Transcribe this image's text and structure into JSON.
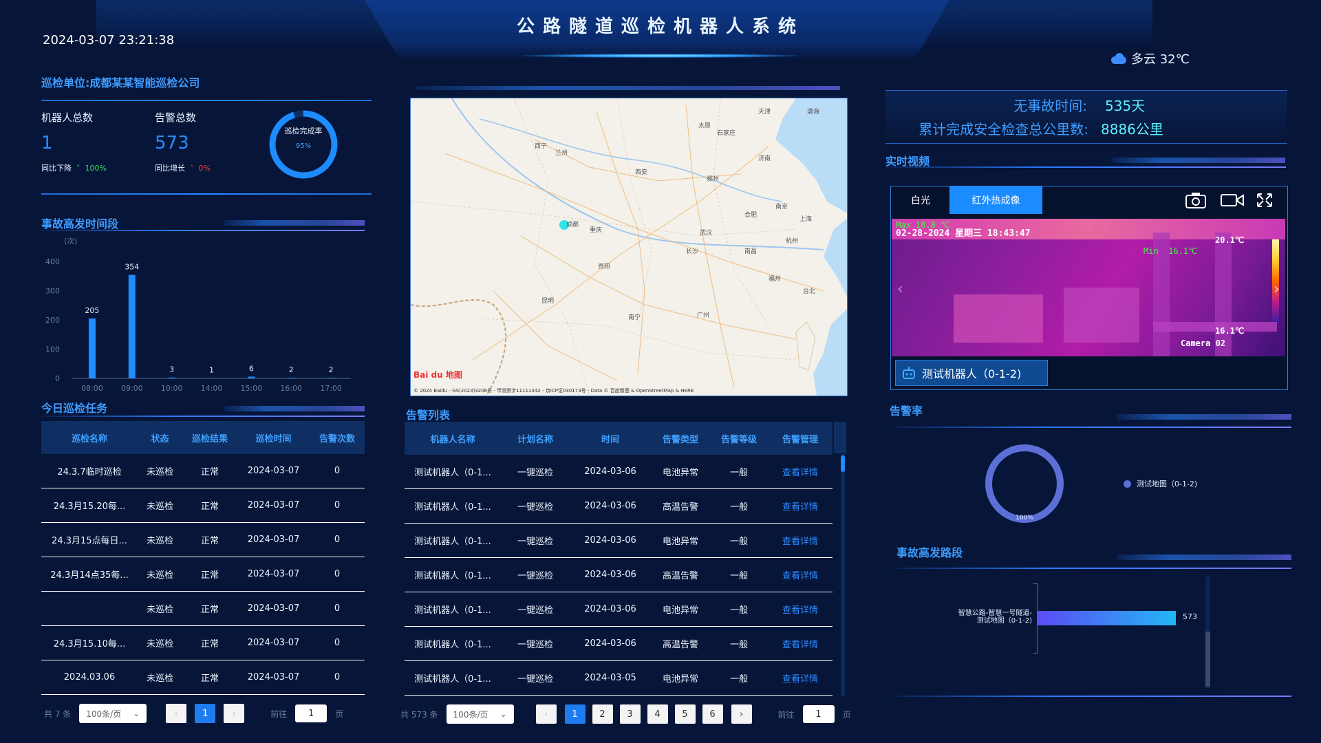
{
  "header": {
    "title": "公路隧道巡检机器人系统",
    "datetime": "2024-03-07 23:21:38",
    "weather": "多云 32℃"
  },
  "left": {
    "unit": "巡检单位:成都某某智能巡检公司",
    "robots_label": "机器人总数",
    "robots_value": "1",
    "robots_cmp_label": "同比下降",
    "robots_cmp_value": "100%",
    "alarms_label": "告警总数",
    "alarms_value": "573",
    "alarms_cmp_label": "同比增长",
    "alarms_cmp_value": "0%",
    "ring_label": "巡检完成率",
    "ring_value": "95%",
    "ring_fraction": 0.95
  },
  "accident_time": {
    "title": "事故高发时间段",
    "unit": "(次)"
  },
  "chart_data": {
    "type": "bar",
    "title": "事故高发时间段",
    "ylabel": "(次)",
    "categories": [
      "08:00",
      "09:00",
      "10:00",
      "14:00",
      "15:00",
      "16:00",
      "17:00"
    ],
    "values": [
      205,
      354,
      3,
      1,
      6,
      2,
      2
    ],
    "yticks": [
      "0",
      "100",
      "200",
      "300",
      "400"
    ],
    "ylim": [
      0,
      400
    ],
    "color": "#1e8cff"
  },
  "task_table": {
    "title": "今日巡检任务",
    "headers": [
      "巡检名称",
      "状态",
      "巡检结果",
      "巡检时间",
      "告警次数"
    ],
    "rows": [
      [
        "24.3.7临时巡检",
        "未巡检",
        "正常",
        "2024-03-07",
        "0"
      ],
      [
        "24.3月15.20每...",
        "未巡检",
        "正常",
        "2024-03-07",
        "0"
      ],
      [
        "24.3月15点每日...",
        "未巡检",
        "正常",
        "2024-03-07",
        "0"
      ],
      [
        "24.3月14点35每...",
        "未巡检",
        "正常",
        "2024-03-07",
        "0"
      ],
      [
        "",
        "未巡检",
        "正常",
        "2024-03-07",
        "0"
      ],
      [
        "24.3月15.10每...",
        "未巡检",
        "正常",
        "2024-03-07",
        "0"
      ],
      [
        "2024.03.06",
        "未巡检",
        "正常",
        "2024-03-07",
        "0"
      ]
    ],
    "total": "共 7 条",
    "page_size": "100条/页",
    "pages": [
      "1"
    ],
    "goto_prefix": "前往",
    "goto_value": "1",
    "goto_suffix": "页"
  },
  "map": {
    "copyright": "© 2024 Baidu - GS(2023)3206号 - 甲测资字11111342 - 京ICP证030173号 - Data © 百度智图 & OpenStreetMap & HERE",
    "logo": "Bai du 地图",
    "cities": [
      "天津",
      "渤海",
      "太原",
      "石家庄",
      "西宁",
      "兰州",
      "济南",
      "西安",
      "郑州",
      "南京",
      "合肥",
      "上海",
      "成都",
      "重庆",
      "武汉",
      "杭州",
      "长沙",
      "南昌",
      "贵阳",
      "福州",
      "昆明",
      "台北",
      "南宁",
      "广州"
    ]
  },
  "alarm_table": {
    "title": "告警列表",
    "headers": [
      "机器人名称",
      "计划名称",
      "时间",
      "告警类型",
      "告警等级",
      "告警管理"
    ],
    "rows": [
      [
        "测试机器人（0-1...",
        "一键巡检",
        "2024-03-06",
        "电池异常",
        "一般",
        "查看详情"
      ],
      [
        "测试机器人（0-1...",
        "一键巡检",
        "2024-03-06",
        "高温告警",
        "一般",
        "查看详情"
      ],
      [
        "测试机器人（0-1...",
        "一键巡检",
        "2024-03-06",
        "电池异常",
        "一般",
        "查看详情"
      ],
      [
        "测试机器人（0-1...",
        "一键巡检",
        "2024-03-06",
        "高温告警",
        "一般",
        "查看详情"
      ],
      [
        "测试机器人（0-1...",
        "一键巡检",
        "2024-03-06",
        "电池异常",
        "一般",
        "查看详情"
      ],
      [
        "测试机器人（0-1...",
        "一键巡检",
        "2024-03-06",
        "高温告警",
        "一般",
        "查看详情"
      ],
      [
        "测试机器人（0-1...",
        "一键巡检",
        "2024-03-05",
        "电池异常",
        "一般",
        "查看详情"
      ]
    ],
    "total": "共 573 条",
    "page_size": "100条/页",
    "pages": [
      "1",
      "2",
      "3",
      "4",
      "5",
      "6"
    ],
    "goto_prefix": "前往",
    "goto_value": "1",
    "goto_suffix": "页"
  },
  "right": {
    "no_accident_label": "无事故时间:",
    "no_accident_value": "535天",
    "checked_label": "累计完成安全检查总公里数:",
    "checked_value": "8886公里",
    "video_title": "实时视频",
    "tab_white": "白光",
    "tab_ir": "红外热成像",
    "osd_date": "02-28-2024  星期三  18:43:47",
    "osd_top": "Max 18.8 ℃",
    "osd_max": "20.1℃",
    "osd_min_label": "Min",
    "osd_min": "16.1℃",
    "osd_bottom": "16.1℃",
    "osd_camera": "Camera 02",
    "robot_tag": "测试机器人（0-1-2)",
    "alarm_rate_title": "告警率",
    "alarm_rate_value": "100%",
    "alarm_rate_fraction": 1.0,
    "alarm_rate_legend": "测试地图（0-1-2)",
    "road_title": "事故高发路段",
    "road_label_1": "智慧公路-智慧一号隧道-",
    "road_label_2": "测试地图（0-1-2)",
    "road_value": 573,
    "road_value_text": "573"
  }
}
